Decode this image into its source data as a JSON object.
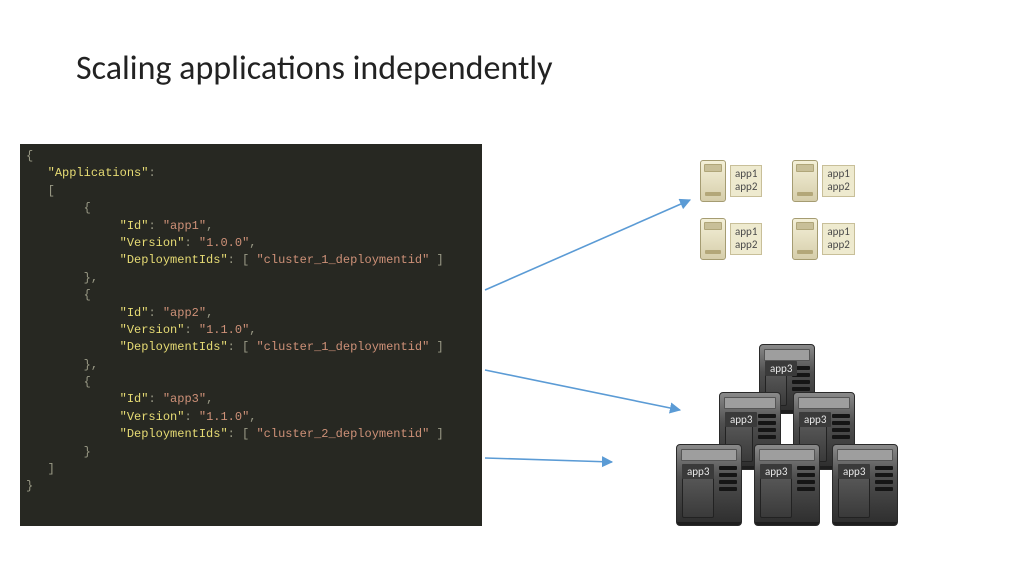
{
  "title": "Scaling applications independently",
  "code": {
    "root_key": "Applications",
    "apps": [
      {
        "id": "app1",
        "version": "1.0.0",
        "deployment": "cluster_1_deploymentid",
        "trailing": ","
      },
      {
        "id": "app2",
        "version": "1.1.0",
        "deployment": "cluster_1_deploymentid",
        "trailing": ","
      },
      {
        "id": "app3",
        "version": "1.1.0",
        "deployment": "cluster_2_deploymentid",
        "trailing": ""
      }
    ],
    "labels": {
      "id": "Id",
      "version": "Version",
      "deployment": "DeploymentIds"
    }
  },
  "cluster1": {
    "unit_label_line1": "app1",
    "unit_label_line2": "app2",
    "count": 4
  },
  "cluster2": {
    "label": "app3",
    "rows": [
      1,
      2,
      3
    ]
  },
  "colors": {
    "code_bg": "#272822",
    "arrow": "#5b9bd5"
  }
}
